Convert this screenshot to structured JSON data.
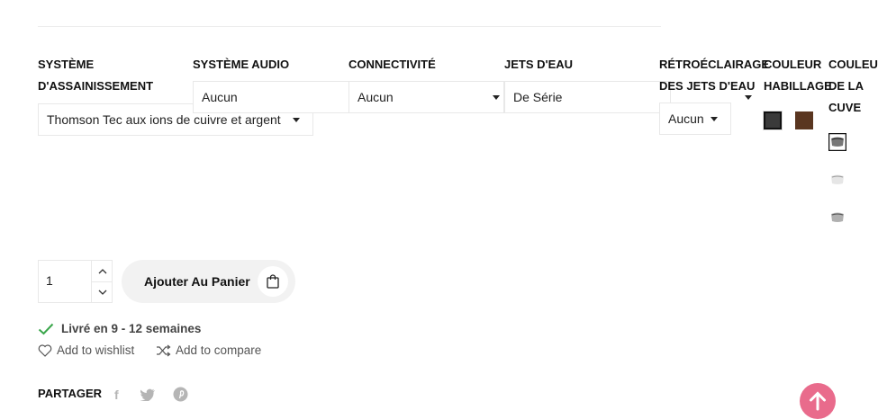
{
  "options": [
    {
      "label_line1": "SYSTÈME",
      "label_line2": "D'ASSAINISSEMENT",
      "value": "Thomson Tec aux ions de cuivre et argent"
    },
    {
      "label": "SYSTÈME AUDIO",
      "value": "Aucun"
    },
    {
      "label": "CONNECTIVITÉ",
      "value": "Aucun"
    },
    {
      "label": "JETS D'EAU",
      "value": "De Série"
    },
    {
      "label_line1": "RÉTROÉCLAIRAGE",
      "label_line2": "DES JETS D'EAU",
      "value": "Aucun"
    },
    {
      "label_line1": "COULEUR",
      "label_line2": "HABILLAGE",
      "swatches": [
        "#3a3a3a",
        "#5a3620"
      ]
    },
    {
      "label_line1": "COULEU",
      "label_line2": "DE LA",
      "label_line3": "CUVE"
    }
  ],
  "quantity": {
    "value": "1"
  },
  "cart": {
    "label": "Ajouter Au Panier"
  },
  "delivery": {
    "text": "Livré en 9 - 12 semaines"
  },
  "links": {
    "wishlist": "Add to wishlist",
    "compare": "Add to compare"
  },
  "share": {
    "label": "PARTAGER",
    "networks": [
      "facebook-icon",
      "twitter-icon",
      "pinterest-icon"
    ]
  },
  "colors": {
    "accent": "#e96b8c",
    "check": "#3aa64b"
  }
}
